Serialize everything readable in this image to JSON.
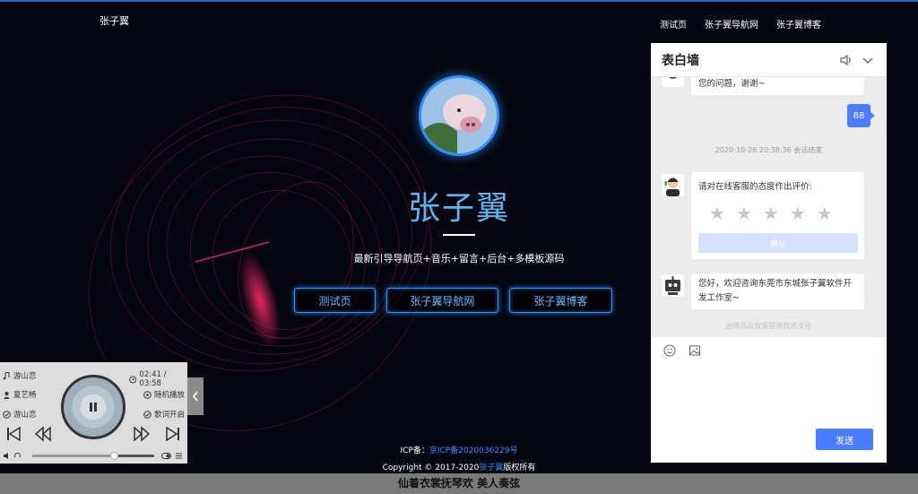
{
  "colors": {
    "accent": "#2d8fff",
    "hero_name": "#5cb5f0",
    "chat_send": "#4a7dff",
    "swirl": "#ff2a6d"
  },
  "header": {
    "brand": "张子翼",
    "nav": [
      "测试页",
      "张子翼导航网",
      "张子翼博客"
    ]
  },
  "hero": {
    "name": "张子翼",
    "subtitle": "最新引导导航页+音乐+留言+后台+多模板源码",
    "buttons": [
      "测试页",
      "张子翼导航网",
      "张子翼博客"
    ]
  },
  "footer": {
    "icp_label": "ICP备：",
    "icp_link": "京ICP备2020036229号",
    "copyright_prefix": "Copyright © 2017-2020",
    "copyright_link": "张子翼",
    "copyright_suffix": "版权所有",
    "lyric": "仙着衣裳抚琴欢 美人奏弦"
  },
  "chat": {
    "title": "表白墙",
    "icons": [
      "speaker-icon",
      "chevron-down-icon"
    ],
    "msg_partial": "您的问题，谢谢~",
    "msg_me": "88",
    "session_end": "2020-10-26 20:38:36 会话结束",
    "rate_question": "请对在线客服的态度作出评价:",
    "star_count": 5,
    "confirm": "确认",
    "welcome": "您好，欢迎咨询东莞市东城张子翼软件开发工作室~",
    "powered": "由腾讯云智服提供技术支持",
    "tools": [
      "emoji-icon",
      "image-icon"
    ],
    "send": "发送"
  },
  "player": {
    "song_top": "游山恋",
    "time": "02:41 / 03:58",
    "artist": "夏艺畅",
    "mode": "随机播放",
    "album": "游山恋",
    "lyrics_toggle": "歌词开启",
    "progress": 0.67
  }
}
